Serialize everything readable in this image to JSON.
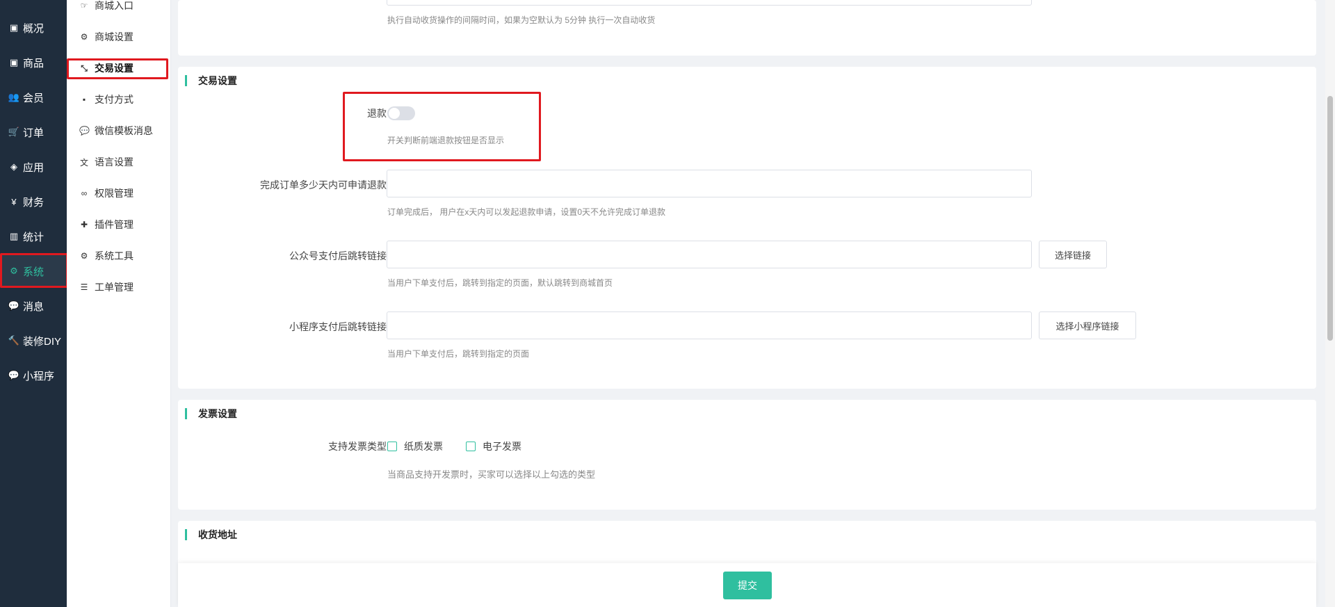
{
  "nav": {
    "items": [
      {
        "label": "概况",
        "icon": "archive-icon"
      },
      {
        "label": "商品",
        "icon": "archive-icon"
      },
      {
        "label": "会员",
        "icon": "users-icon"
      },
      {
        "label": "订单",
        "icon": "cart-icon"
      },
      {
        "label": "应用",
        "icon": "cubes-icon"
      },
      {
        "label": "财务",
        "icon": "yen-icon"
      },
      {
        "label": "统计",
        "icon": "bar-chart-icon"
      },
      {
        "label": "系统",
        "icon": "gears-icon"
      },
      {
        "label": "消息",
        "icon": "comment-icon"
      },
      {
        "label": "装修DIY",
        "icon": "hammer-icon"
      },
      {
        "label": "小程序",
        "icon": "wechat-icon"
      }
    ],
    "active": "系统"
  },
  "submenu": {
    "items": [
      {
        "label": "商城入口",
        "icon": "hand-point-icon"
      },
      {
        "label": "商城设置",
        "icon": "gear-icon"
      },
      {
        "label": "交易设置",
        "icon": "compress-icon"
      },
      {
        "label": "支付方式",
        "icon": "facebook-square-icon"
      },
      {
        "label": "微信模板消息",
        "icon": "wechat-icon"
      },
      {
        "label": "语言设置",
        "icon": "language-icon"
      },
      {
        "label": "权限管理",
        "icon": "glasses-icon"
      },
      {
        "label": "插件管理",
        "icon": "puzzle-icon"
      },
      {
        "label": "系统工具",
        "icon": "gear-icon"
      },
      {
        "label": "工单管理",
        "icon": "list-icon"
      }
    ],
    "active": "交易设置"
  },
  "top_card": {
    "tip": "执行自动收货操作的间隔时间，如果为空默认为 5分钟 执行一次自动收货"
  },
  "trade": {
    "title": "交易设置",
    "refund_label": "退款",
    "refund_enabled": false,
    "refund_tip": "开关判断前端退款按钮是否显示",
    "refund_days_label": "完成订单多少天内可申请退款",
    "refund_days_value": "",
    "refund_days_tip": "订单完成后， 用户在x天内可以发起退款申请，设置0天不允许完成订单退款",
    "mp_link_label": "公众号支付后跳转链接",
    "mp_link_value": "",
    "mp_link_button": "选择链接",
    "mp_link_tip": "当用户下单支付后，跳转到指定的页面，默认跳转到商城首页",
    "mini_link_label": "小程序支付后跳转链接",
    "mini_link_value": "",
    "mini_link_button": "选择小程序链接",
    "mini_link_tip": "当用户下单支付后，跳转到指定的页面"
  },
  "invoice": {
    "title": "发票设置",
    "type_label": "支持发票类型",
    "options": [
      {
        "label": "纸质发票",
        "checked": false
      },
      {
        "label": "电子发票",
        "checked": false
      }
    ],
    "tip": "当商品支持开发票时，买家可以选择以上勾选的类型"
  },
  "address": {
    "title": "收货地址"
  },
  "footer": {
    "submit_label": "提交"
  },
  "colors": {
    "nav_bg": "#1f2d3d",
    "accent": "#2fbf9f",
    "highlight_border": "#e0191f"
  }
}
